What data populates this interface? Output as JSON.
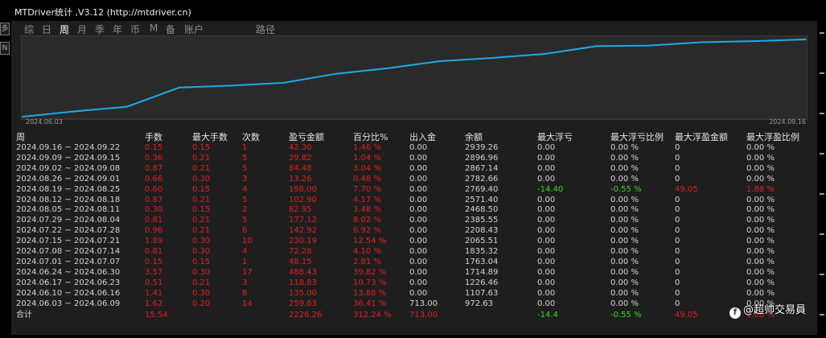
{
  "window": {
    "title": "MTDriver统计 ,V3.12 (http://mtdriver.cn)"
  },
  "left_buttons": [
    "多",
    "N"
  ],
  "tabs": [
    {
      "label": "综",
      "active": false
    },
    {
      "label": "日",
      "active": false
    },
    {
      "label": "周",
      "active": true
    },
    {
      "label": "月",
      "active": false
    },
    {
      "label": "季",
      "active": false
    },
    {
      "label": "年",
      "active": false
    },
    {
      "label": "币",
      "active": false
    },
    {
      "label": "M",
      "active": false
    },
    {
      "label": "备",
      "active": false
    },
    {
      "label": "账户",
      "active": false
    },
    {
      "label": "路径",
      "active": false
    }
  ],
  "chart_data": {
    "type": "line",
    "x_start_label": "2024.06.03",
    "x_end_label": "2024.09.16",
    "series": [
      {
        "color": "#1fa9e8",
        "x": [
          "2024.06.03",
          "2024.06.10",
          "2024.06.17",
          "2024.06.24",
          "2024.07.01",
          "2024.07.08",
          "2024.07.15",
          "2024.07.22",
          "2024.07.29",
          "2024.08.05",
          "2024.08.12",
          "2024.08.19",
          "2024.08.26",
          "2024.09.02",
          "2024.09.09",
          "2024.09.16"
        ],
        "values": [
          972.63,
          1107.63,
          1226.46,
          1714.89,
          1763.04,
          1835.32,
          2065.51,
          2208.43,
          2385.55,
          2468.5,
          2571.4,
          2769.4,
          2782.66,
          2867.14,
          2896.96,
          2939.26
        ]
      }
    ],
    "ylim": [
      972.63,
      2939.26
    ],
    "grid": false
  },
  "table": {
    "headers": [
      "周",
      "手数",
      "最大手数",
      "次数",
      "盈亏金额",
      "百分比%",
      "出入金",
      "余额",
      "最大浮亏",
      "最大浮亏比例",
      "最大浮盈金额",
      "最大浮盈比例"
    ],
    "rows": [
      [
        "2024.09.16 ~ 2024.09.22",
        "0.15",
        "0.15",
        "1",
        "42.30",
        "1.46 %",
        "0.00",
        "2939.26",
        "0.00",
        "0.00 %",
        "0",
        "0.00 %"
      ],
      [
        "2024.09.09 ~ 2024.09.15",
        "0.36",
        "0.21",
        "5",
        "29.82",
        "1.04 %",
        "0.00",
        "2896.96",
        "0.00",
        "0.00 %",
        "0",
        "0.00 %"
      ],
      [
        "2024.09.02 ~ 2024.09.08",
        "0.87",
        "0.21",
        "5",
        "84.48",
        "3.04 %",
        "0.00",
        "2867.14",
        "0.00",
        "0.00 %",
        "0",
        "0.00 %"
      ],
      [
        "2024.08.26 ~ 2024.09.01",
        "0.66",
        "0.30",
        "3",
        "13.26",
        "0.48 %",
        "0.00",
        "2782.66",
        "0.00",
        "0.00 %",
        "0",
        "0.00 %"
      ],
      [
        "2024.08.19 ~ 2024.08.25",
        "0.60",
        "0.15",
        "4",
        "198.00",
        "7.70 %",
        "0.00",
        "2769.40",
        "-14.40",
        "-0.55 %",
        "49.05",
        "1.88 %"
      ],
      [
        "2024.08.12 ~ 2024.08.18",
        "0.87",
        "0.21",
        "5",
        "102.90",
        "4.17 %",
        "0.00",
        "2571.40",
        "0.00",
        "0.00 %",
        "0",
        "0.00 %"
      ],
      [
        "2024.08.05 ~ 2024.08.11",
        "0.30",
        "0.15",
        "2",
        "82.95",
        "3.48 %",
        "0.00",
        "2468.50",
        "0.00",
        "0.00 %",
        "0",
        "0.00 %"
      ],
      [
        "2024.07.29 ~ 2024.08.04",
        "0.81",
        "0.21",
        "5",
        "177.12",
        "8.02 %",
        "0.00",
        "2385.55",
        "0.00",
        "0.00 %",
        "0",
        "0.00 %"
      ],
      [
        "2024.07.22 ~ 2024.07.28",
        "0.96",
        "0.21",
        "6",
        "142.92",
        "6.92 %",
        "0.00",
        "2208.43",
        "0.00",
        "0.00 %",
        "0",
        "0.00 %"
      ],
      [
        "2024.07.15 ~ 2024.07.21",
        "1.89",
        "0.30",
        "10",
        "230.19",
        "12.54 %",
        "0.00",
        "2065.51",
        "0.00",
        "0.00 %",
        "0",
        "0.00 %"
      ],
      [
        "2024.07.08 ~ 2024.07.14",
        "0.81",
        "0.30",
        "4",
        "72.28",
        "4.10 %",
        "0.00",
        "1835.32",
        "0.00",
        "0.00 %",
        "0",
        "0.00 %"
      ],
      [
        "2024.07.01 ~ 2024.07.07",
        "0.15",
        "0.15",
        "1",
        "48.15",
        "2.81 %",
        "0.00",
        "1763.04",
        "0.00",
        "0.00 %",
        "0",
        "0.00 %"
      ],
      [
        "2024.06.24 ~ 2024.06.30",
        "3.57",
        "0.30",
        "17",
        "488.43",
        "39.82 %",
        "0.00",
        "1714.89",
        "0.00",
        "0.00 %",
        "0",
        "0.00 %"
      ],
      [
        "2024.06.17 ~ 2024.06.23",
        "0.51",
        "0.21",
        "3",
        "118.83",
        "10.73 %",
        "0.00",
        "1226.46",
        "0.00",
        "0.00 %",
        "0",
        "0.00 %"
      ],
      [
        "2024.06.10 ~ 2024.06.16",
        "1.41",
        "0.30",
        "8",
        "135.00",
        "13.88 %",
        "0.00",
        "1107.63",
        "0.00",
        "0.00 %",
        "0",
        "0.00 %"
      ],
      [
        "2024.06.03 ~ 2024.06.09",
        "1.62",
        "0.20",
        "14",
        "259.63",
        "36.41 %",
        "713.00",
        "972.63",
        "0.00",
        "0.00 %",
        "0",
        "0.00 %"
      ]
    ],
    "total": [
      "合计",
      "15.54",
      "",
      "",
      "2226.26",
      "312.24 %",
      "713.00",
      "",
      "-14.4",
      "-0.55 %",
      "49.05",
      "1.88 %"
    ]
  },
  "watermark": {
    "icon_glyph": "f",
    "text": "@超帅交易員"
  },
  "colors": {
    "line": "#1fa9e8",
    "profit": "#e02020",
    "positive_float": "#3bd62a"
  }
}
